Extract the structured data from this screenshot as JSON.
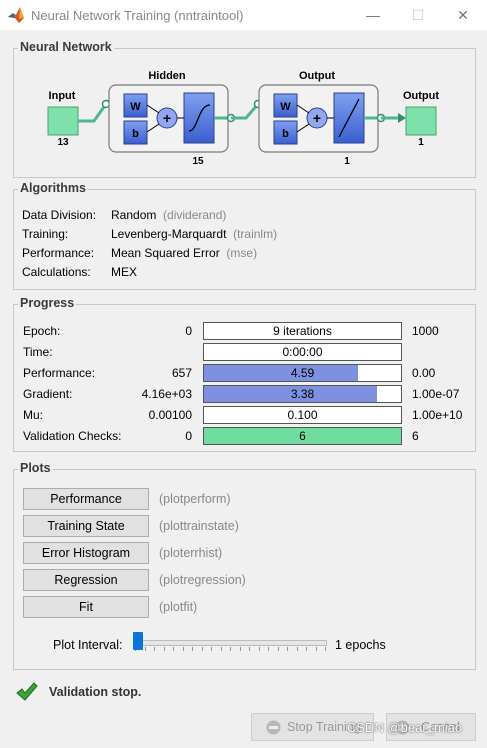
{
  "window": {
    "title": "Neural Network Training (nntraintool)",
    "minimize": "—",
    "maximize": "☐",
    "close": "✕"
  },
  "network": {
    "section_title": "Neural Network",
    "input_label": "Input",
    "input_size": "13",
    "hidden_label": "Hidden",
    "hidden_size": "15",
    "output_layer_label": "Output",
    "output_layer_size": "1",
    "output_label": "Output",
    "output_size": "1",
    "w_symbol": "W",
    "b_symbol": "b",
    "plus": "+"
  },
  "algorithms": {
    "section_title": "Algorithms",
    "rows": [
      {
        "label": "Data Division:",
        "value": "Random",
        "fn": "(dividerand)"
      },
      {
        "label": "Training:",
        "value": "Levenberg-Marquardt",
        "fn": "(trainlm)"
      },
      {
        "label": "Performance:",
        "value": "Mean Squared Error",
        "fn": "(mse)"
      },
      {
        "label": "Calculations:",
        "value": "MEX",
        "fn": ""
      }
    ]
  },
  "progress": {
    "section_title": "Progress",
    "rows": [
      {
        "label": "Epoch:",
        "start": "0",
        "bar_text": "9 iterations",
        "end": "1000",
        "fill": 0.0,
        "color": "#ffffff"
      },
      {
        "label": "Time:",
        "start": "",
        "bar_text": "0:00:00",
        "end": "",
        "fill": 0.0,
        "color": "#ffffff"
      },
      {
        "label": "Performance:",
        "start": "657",
        "bar_text": "4.59",
        "end": "0.00",
        "fill": 0.78,
        "color": "#7d91e0"
      },
      {
        "label": "Gradient:",
        "start": "4.16e+03",
        "bar_text": "3.38",
        "end": "1.00e-07",
        "fill": 0.88,
        "color": "#7d91e0"
      },
      {
        "label": "Mu:",
        "start": "0.00100",
        "bar_text": "0.100",
        "end": "1.00e+10",
        "fill": 0.0,
        "color": "#ffffff"
      },
      {
        "label": "Validation Checks:",
        "start": "0",
        "bar_text": "6",
        "end": "6",
        "fill": 1.0,
        "color": "#70dca0"
      }
    ]
  },
  "plots": {
    "section_title": "Plots",
    "buttons": [
      {
        "label": "Performance",
        "fn": "(plotperform)"
      },
      {
        "label": "Training State",
        "fn": "(plottrainstate)"
      },
      {
        "label": "Error Histogram",
        "fn": "(ploterrhist)"
      },
      {
        "label": "Regression",
        "fn": "(plotregression)"
      },
      {
        "label": "Fit",
        "fn": "(plotfit)"
      }
    ],
    "interval_label": "Plot Interval:",
    "interval_value": "1 epochs",
    "interval_fraction": 0.0
  },
  "status": {
    "message": "Validation stop."
  },
  "footer": {
    "stop_label": "Stop Training",
    "cancel_label": "Cancel",
    "watermark": "CSDN @bear_miao"
  }
}
